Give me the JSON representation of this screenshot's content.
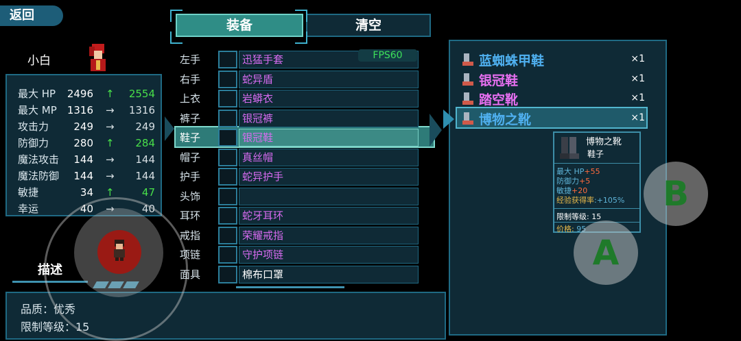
{
  "header": {
    "back_label": "返回"
  },
  "character": {
    "name": "小白"
  },
  "stats": [
    {
      "label": "最大 HP",
      "current": "2496",
      "trend": "up",
      "next": "2554"
    },
    {
      "label": "最大 MP",
      "current": "1316",
      "trend": "same",
      "next": "1316"
    },
    {
      "label": "攻击力",
      "current": "249",
      "trend": "same",
      "next": "249"
    },
    {
      "label": "防御力",
      "current": "280",
      "trend": "up",
      "next": "284"
    },
    {
      "label": "魔法攻击",
      "current": "144",
      "trend": "same",
      "next": "144"
    },
    {
      "label": "魔法防御",
      "current": "144",
      "trend": "same",
      "next": "144"
    },
    {
      "label": "敏捷",
      "current": "34",
      "trend": "up",
      "next": "47"
    },
    {
      "label": "幸运",
      "current": "40",
      "trend": "same",
      "next": "40"
    }
  ],
  "tabs": {
    "equip": "装备",
    "clear": "清空"
  },
  "fps": "FPS60",
  "slots": [
    {
      "label": "左手",
      "item": "迅猛手套",
      "color": "purple",
      "icon": "glove-icon"
    },
    {
      "label": "右手",
      "item": "蛇异盾",
      "color": "purple",
      "icon": "shield-icon"
    },
    {
      "label": "上衣",
      "item": "岩蟒衣",
      "color": "purple",
      "icon": "armor-icon"
    },
    {
      "label": "裤子",
      "item": "银冠裤",
      "color": "purple",
      "icon": "pants-icon"
    },
    {
      "label": "鞋子",
      "item": "银冠鞋",
      "color": "purple",
      "icon": "boots-icon",
      "selected": true
    },
    {
      "label": "帽子",
      "item": "真丝帽",
      "color": "purple",
      "icon": "hat-icon"
    },
    {
      "label": "护手",
      "item": "蛇异护手",
      "color": "purple",
      "icon": "gauntlet-icon"
    },
    {
      "label": "头饰",
      "item": "",
      "color": "white",
      "icon": ""
    },
    {
      "label": "耳环",
      "item": "蛇牙耳环",
      "color": "purple",
      "icon": "earring-icon"
    },
    {
      "label": "戒指",
      "item": "荣耀戒指",
      "color": "purple",
      "icon": "ring-icon"
    },
    {
      "label": "项链",
      "item": "守护项链",
      "color": "purple",
      "icon": "necklace-icon"
    },
    {
      "label": "面具",
      "item": "棉布口罩",
      "color": "white",
      "icon": "mask-icon"
    }
  ],
  "inventory": [
    {
      "name": "蓝蜘蛛甲鞋",
      "count": "×1",
      "color": "#4fb0f0"
    },
    {
      "name": "银冠鞋",
      "count": "×1",
      "color": "#e66ff0"
    },
    {
      "name": "踏空靴",
      "count": "×1",
      "color": "#e66ff0"
    },
    {
      "name": "博物之靴",
      "count": "×1",
      "color": "#4fb0f0",
      "selected": true
    }
  ],
  "tooltip": {
    "name": "博物之靴",
    "type": "鞋子",
    "attrs": [
      {
        "k": "最大 HP",
        "v": "+55"
      },
      {
        "k": "防御力",
        "v": "+5"
      },
      {
        "k": "敏捷",
        "v": "+20"
      },
      {
        "k": "经验获得率",
        "v": ":+105%"
      }
    ],
    "level_label": "限制等级:",
    "level_value": "15",
    "price_label": "价格:",
    "price_value": "95"
  },
  "description": {
    "tab_label": "描述",
    "quality": "品质：优秀",
    "level": "限制等级：15"
  },
  "buttons": {
    "a": "A",
    "b": "B"
  }
}
